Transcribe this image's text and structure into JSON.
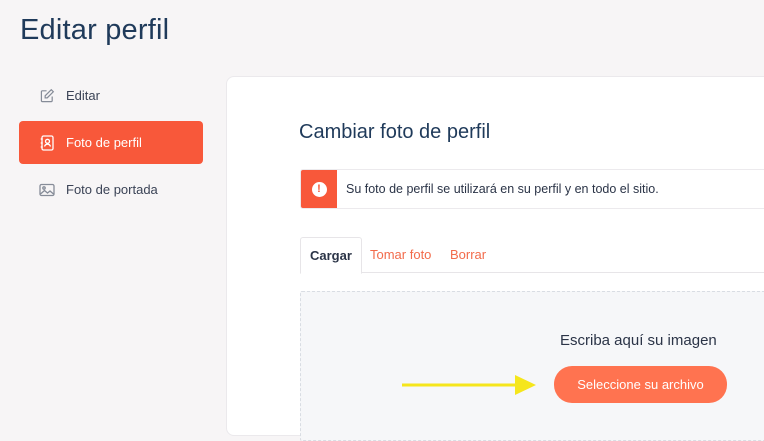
{
  "page": {
    "title": "Editar perfil"
  },
  "sidebar": {
    "items": [
      {
        "label": "Editar",
        "icon": "edit-icon",
        "active": false
      },
      {
        "label": "Foto de perfil",
        "icon": "profile-photo-icon",
        "active": true
      },
      {
        "label": "Foto de portada",
        "icon": "cover-photo-icon",
        "active": false
      }
    ]
  },
  "main": {
    "title": "Cambiar foto de perfil",
    "alert": {
      "icon": "info-icon",
      "text": "Su foto de perfil se utilizará en su perfil y en todo el sitio."
    },
    "tabs": [
      {
        "label": "Cargar",
        "active": true
      },
      {
        "label": "Tomar foto",
        "active": false
      },
      {
        "label": "Borrar",
        "active": false
      }
    ],
    "dropzone": {
      "label": "Escriba aquí su imagen",
      "button_label": "Seleccione su archivo"
    }
  },
  "annotation": {
    "icon": "arrow-right-icon",
    "color": "#f5e61c"
  },
  "colors": {
    "accent": "#f8583a",
    "button": "#ff7350",
    "title": "#1f3a5a"
  }
}
